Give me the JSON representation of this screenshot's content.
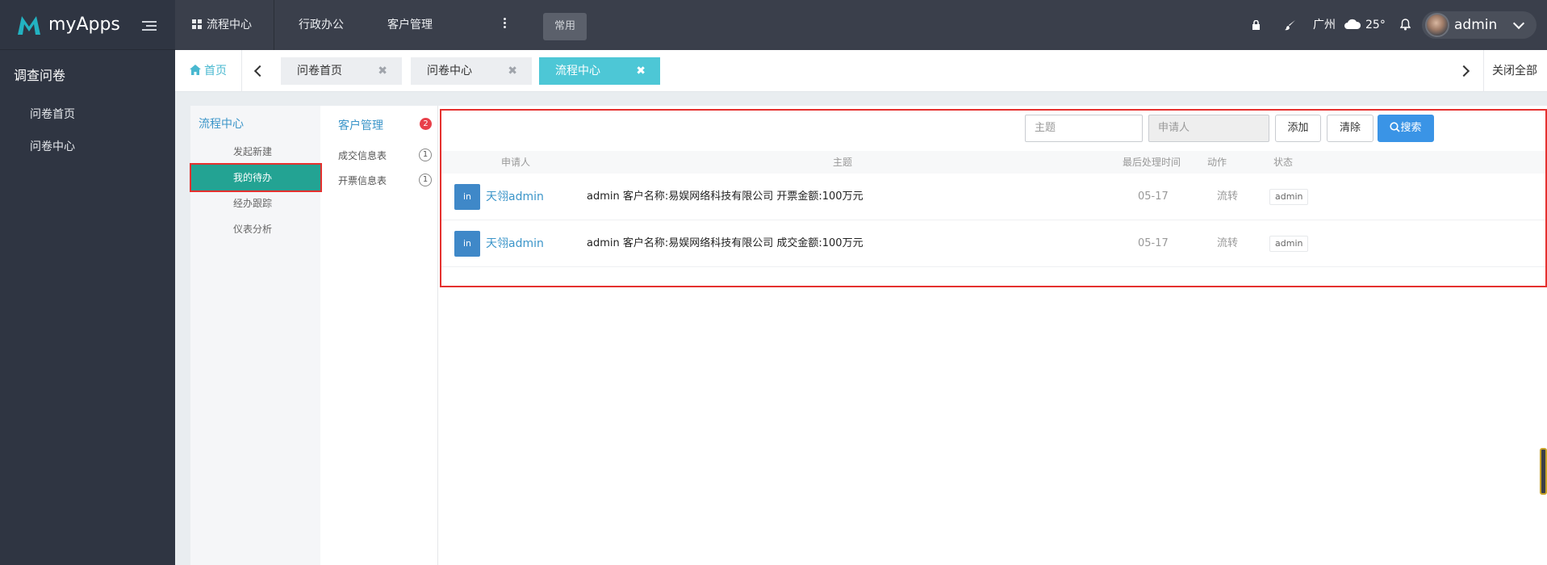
{
  "app": {
    "title": "myApps",
    "brand_color": "#23b2c1"
  },
  "sidebar": {
    "section_title": "调查问卷",
    "items": [
      {
        "label": "问卷首页"
      },
      {
        "label": "问卷中心"
      }
    ]
  },
  "topbar": {
    "nav": [
      {
        "label": "流程中心",
        "icon": "grid-icon"
      },
      {
        "label": "行政办公"
      },
      {
        "label": "客户管理"
      }
    ],
    "common_label": "常用",
    "city": "广州",
    "temperature": "25°",
    "user": "admin"
  },
  "tabs": {
    "home_label": "首页",
    "items": [
      {
        "label": "问卷首页"
      },
      {
        "label": "问卷中心"
      },
      {
        "label": "流程中心",
        "active": true
      }
    ],
    "close_symbol": "✖",
    "close_all_label": "关闭全部"
  },
  "flow_menu": {
    "title": "流程中心",
    "items": [
      {
        "label": "发起新建"
      },
      {
        "label": "我的待办",
        "active": true
      },
      {
        "label": "经办跟踪"
      },
      {
        "label": "仪表分析"
      }
    ]
  },
  "category_menu": {
    "title": "客户管理",
    "count": "2",
    "items": [
      {
        "label": "成交信息表",
        "count": "1"
      },
      {
        "label": "开票信息表",
        "count": "1"
      }
    ]
  },
  "toolbar": {
    "subject_placeholder": "主题",
    "applicant_placeholder": "申请人",
    "add_label": "添加",
    "clear_label": "清除",
    "search_label": "搜索"
  },
  "table": {
    "headers": {
      "applicant": "申请人",
      "subject": "主题",
      "last_time": "最后处理时间",
      "action": "动作",
      "status": "状态"
    },
    "rows": [
      {
        "icon_text": "in",
        "applicant": "天翎admin",
        "subject": "admin 客户名称:易娱网络科技有限公司 开票金额:100万元",
        "time": "05-17",
        "action": "流转",
        "status": "admin"
      },
      {
        "icon_text": "in",
        "applicant": "天翎admin",
        "subject": "admin 客户名称:易娱网络科技有限公司 成交金额:100万元",
        "time": "05-17",
        "action": "流转",
        "status": "admin"
      }
    ]
  }
}
